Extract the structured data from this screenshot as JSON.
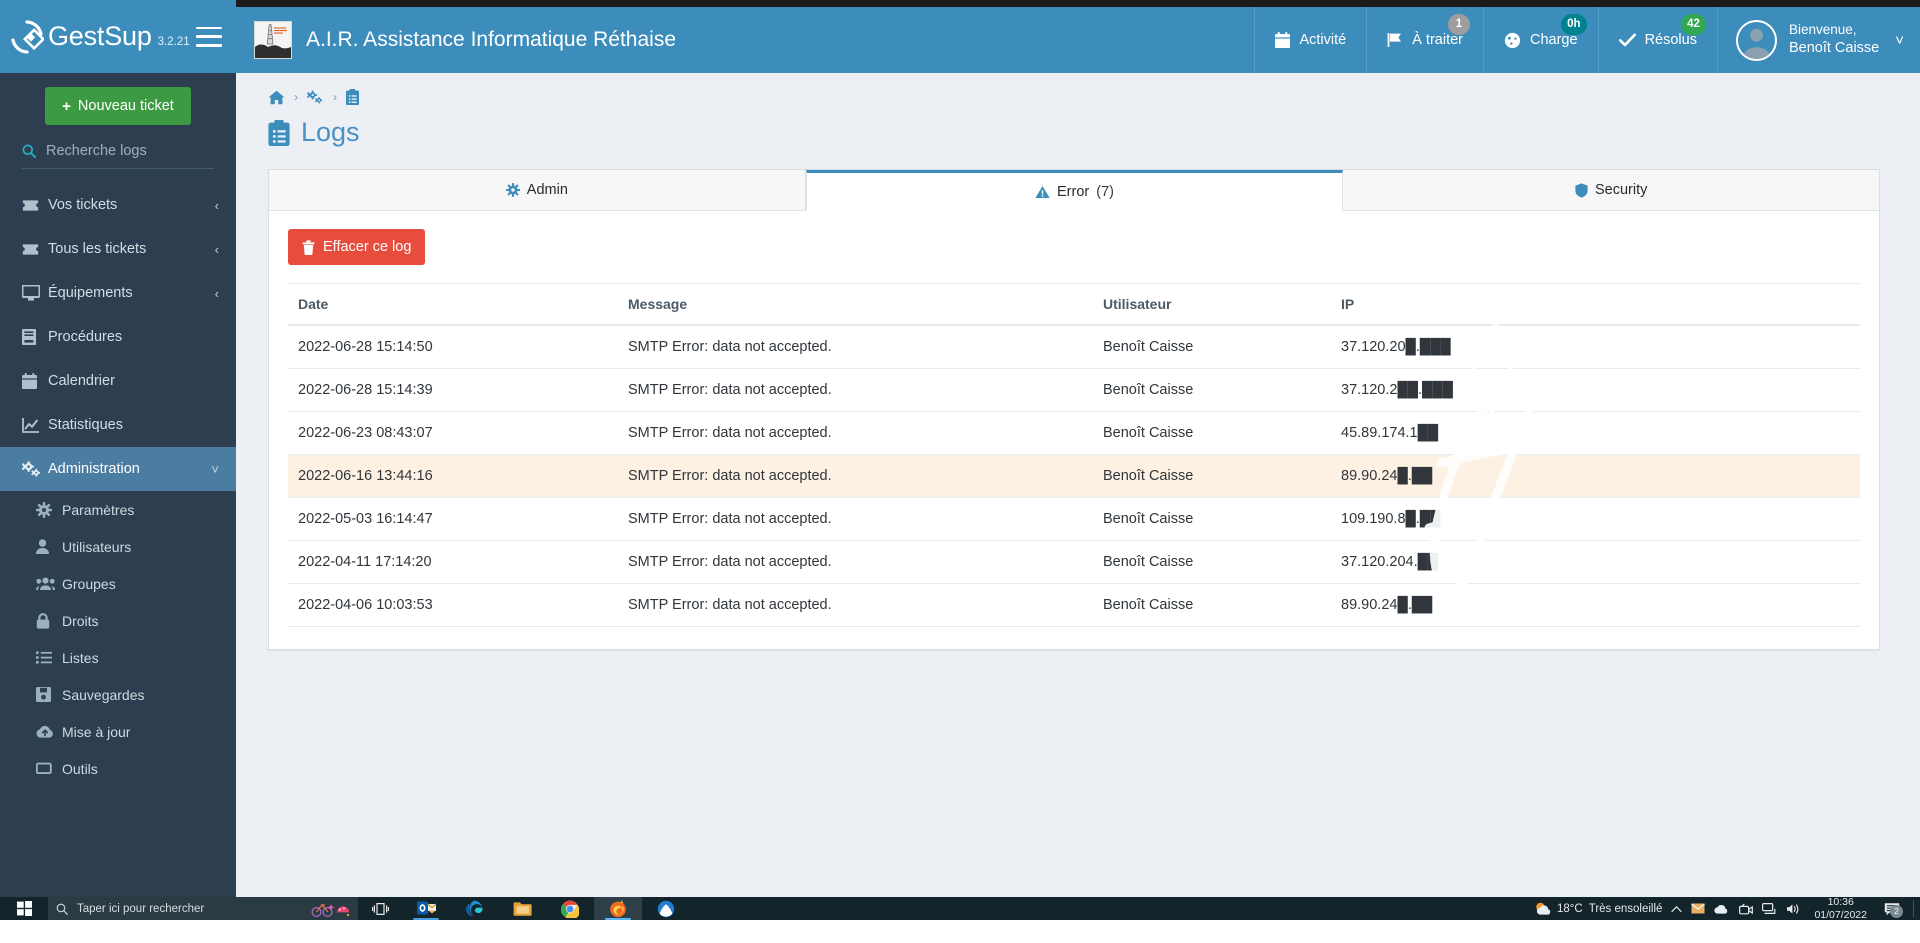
{
  "brand": {
    "name": "GestSup",
    "version": "3.2.21",
    "logo_icon": "gestsup-diamond-logo",
    "menu_toggle_icon": "hamburger-icon"
  },
  "sidebar": {
    "new_ticket_label": "Nouveau ticket",
    "new_ticket_icon": "plus-icon",
    "search": {
      "placeholder": "Recherche logs",
      "value": "",
      "icon": "search-icon"
    },
    "items": [
      {
        "label": "Vos tickets",
        "icon": "ticket-icon",
        "caret": "chevron-left-icon",
        "active": false
      },
      {
        "label": "Tous les tickets",
        "icon": "ticket-icon",
        "caret": "chevron-left-icon",
        "active": false
      },
      {
        "label": "Équipements",
        "icon": "desktop-icon",
        "caret": "chevron-left-icon",
        "active": false
      },
      {
        "label": "Procédures",
        "icon": "book-icon",
        "caret": "",
        "active": false
      },
      {
        "label": "Calendrier",
        "icon": "calendar-icon",
        "caret": "",
        "active": false
      },
      {
        "label": "Statistiques",
        "icon": "chart-line-icon",
        "caret": "",
        "active": false
      },
      {
        "label": "Administration",
        "icon": "cogs-icon",
        "caret": "chevron-down-icon",
        "active": true
      }
    ],
    "subitems": [
      {
        "label": "Paramètres",
        "icon": "gear-icon"
      },
      {
        "label": "Utilisateurs",
        "icon": "user-icon"
      },
      {
        "label": "Groupes",
        "icon": "users-icon"
      },
      {
        "label": "Droits",
        "icon": "lock-icon"
      },
      {
        "label": "Listes",
        "icon": "list-icon"
      },
      {
        "label": "Sauvegardes",
        "icon": "save-icon"
      },
      {
        "label": "Mise à jour",
        "icon": "cloud-upload-icon"
      },
      {
        "label": "Outils",
        "icon": "tools-icon"
      }
    ]
  },
  "header": {
    "app_title": "A.I.R. Assistance Informatique Réthaise",
    "app_logo_icon": "lighthouse-logo",
    "nav": [
      {
        "label": "Activité",
        "icon": "calendar-icon",
        "badge": "",
        "badge_style": ""
      },
      {
        "label": "À traiter",
        "icon": "flag-icon",
        "badge": "1",
        "badge_style": "grey"
      },
      {
        "label": "Charge",
        "icon": "gauge-icon",
        "badge": "0h",
        "badge_style": "teal"
      },
      {
        "label": "Résolus",
        "icon": "check-icon",
        "badge": "42",
        "badge_style": "green"
      }
    ],
    "user": {
      "greeting": "Bienvenue,",
      "name": "Benoît Caisse",
      "avatar_icon": "user-avatar-icon",
      "caret_icon": "chevron-down-icon"
    }
  },
  "breadcrumb": {
    "items": [
      {
        "icon": "home-icon"
      },
      {
        "icon": "cogs-icon"
      },
      {
        "icon": "clipboard-list-icon"
      }
    ],
    "separator": "›"
  },
  "page": {
    "title": "Logs",
    "title_icon": "clipboard-list-icon"
  },
  "tabs": [
    {
      "label": "Admin",
      "icon": "gear-icon",
      "count": "",
      "active": false
    },
    {
      "label": "Error",
      "icon": "warning-icon",
      "count": "(7)",
      "active": true
    },
    {
      "label": "Security",
      "icon": "shield-icon",
      "count": "",
      "active": false
    }
  ],
  "actions": {
    "clear_log_label": "Effacer ce log",
    "clear_log_icon": "trash-icon"
  },
  "table": {
    "headers": [
      "Date",
      "Message",
      "Utilisateur",
      "IP"
    ],
    "rows": [
      {
        "date": "2022-06-28 15:14:50",
        "message": "SMTP Error: data not accepted.",
        "user": "Benoît Caisse",
        "ip": "37.120.20█.███",
        "highlighted": false
      },
      {
        "date": "2022-06-28 15:14:39",
        "message": "SMTP Error: data not accepted.",
        "user": "Benoît Caisse",
        "ip": "37.120.2██.███",
        "highlighted": false
      },
      {
        "date": "2022-06-23 08:43:07",
        "message": "SMTP Error: data not accepted.",
        "user": "Benoît Caisse",
        "ip": "45.89.174.1██",
        "highlighted": false
      },
      {
        "date": "2022-06-16 13:44:16",
        "message": "SMTP Error: data not accepted.",
        "user": "Benoît Caisse",
        "ip": "89.90.24█.██",
        "highlighted": true
      },
      {
        "date": "2022-05-03 16:14:47",
        "message": "SMTP Error: data not accepted.",
        "user": "Benoît Caisse",
        "ip": "109.190.8█.██",
        "highlighted": false
      },
      {
        "date": "2022-04-11 17:14:20",
        "message": "SMTP Error: data not accepted.",
        "user": "Benoît Caisse",
        "ip": "37.120.204.██",
        "highlighted": false
      },
      {
        "date": "2022-04-06 10:03:53",
        "message": "SMTP Error: data not accepted.",
        "user": "Benoît Caisse",
        "ip": "89.90.24█.██",
        "highlighted": false
      }
    ]
  },
  "taskbar": {
    "start_icon": "windows-start-icon",
    "search_placeholder": "Taper ici pour rechercher",
    "search_icon": "search-icon",
    "sticker_icons": [
      "bicycle-sticker",
      "helmet-sticker"
    ],
    "taskview_icon": "task-view-icon",
    "apps": [
      {
        "name": "outlook-icon",
        "active": false
      },
      {
        "name": "edge-icon",
        "active": false
      },
      {
        "name": "explorer-icon",
        "active": false
      },
      {
        "name": "chrome-icon",
        "active": false
      },
      {
        "name": "firefox-icon",
        "active": true
      },
      {
        "name": "browser-icon",
        "active": false
      }
    ],
    "tray": {
      "weather_icon": "sun-cloud-icon",
      "temperature": "18°C",
      "condition": "Très ensoleillé",
      "chevron_icon": "chevron-up-icon",
      "icons": [
        "mail-icon",
        "onedrive-icon",
        "meet-icon",
        "network-icon",
        "volume-icon"
      ],
      "time": "10:36",
      "date": "01/07/2022",
      "notification_icon": "action-center-icon",
      "notification_count": "2"
    }
  },
  "colors": {
    "brand_blue": "#3c8dbc",
    "sidebar_dark": "#2c3e50",
    "sidebar_active": "#4b7ca2",
    "green": "#3c9a43",
    "danger_red": "#e84c3d",
    "highlight_row": "#fdf1e3",
    "page_bg": "#ecf0f5"
  }
}
